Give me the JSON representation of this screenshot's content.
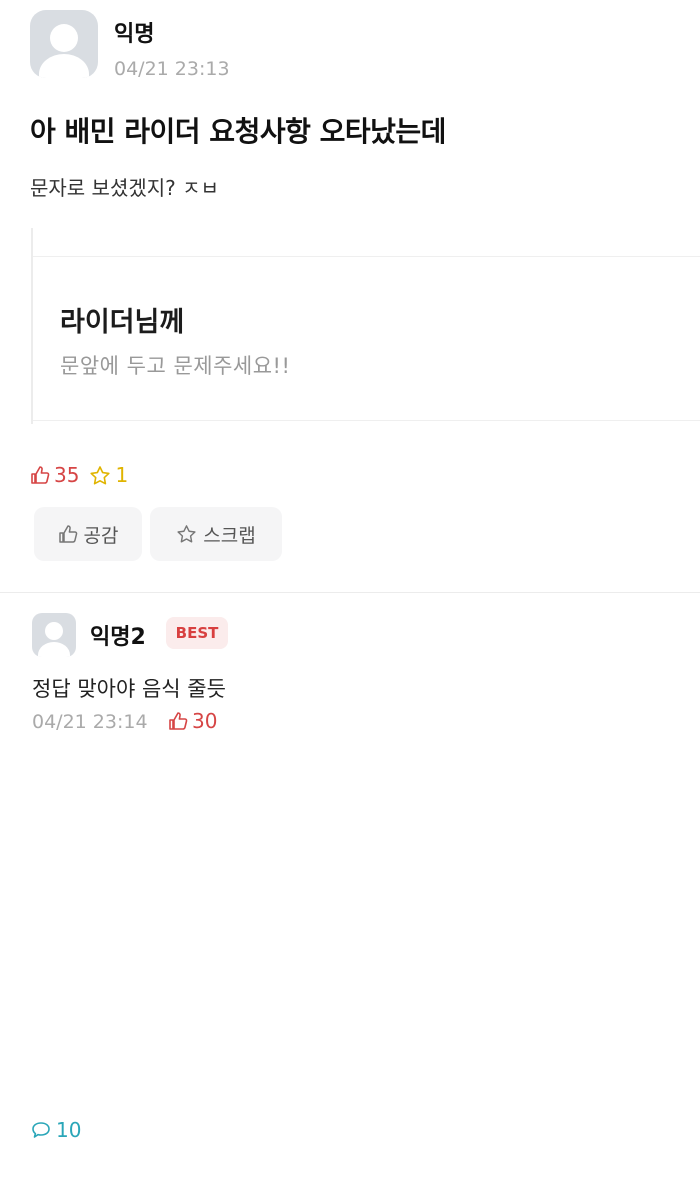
{
  "post": {
    "author": "익명",
    "time": "04/21 23:13",
    "title": "아 배민 라이더 요청사항 오타났는데",
    "body": "문자로 보셨겠지? ㅈㅂ",
    "card": {
      "title": "라이더님께",
      "subtitle": "문앞에 두고 문제주세요!!"
    },
    "stats": {
      "likes": "35",
      "comments": "10",
      "scraps": "1"
    },
    "buttons": {
      "like_label": "공감",
      "scrap_label": "스크랩"
    }
  },
  "comment": {
    "author": "익명2",
    "badge": "BEST",
    "text": "정답 맞아야 음식 줄듯",
    "time": "04/21 23:14",
    "likes": "30"
  },
  "colors": {
    "like": "#d64545",
    "comment": "#2aa6b8",
    "scrap": "#e0b400",
    "best_bg": "#fbecec",
    "best_text": "#d84040"
  },
  "icons": {
    "like": "thumbs-up-icon",
    "comment": "speech-bubble-icon",
    "scrap": "star-icon",
    "avatar": "default-avatar-icon"
  }
}
